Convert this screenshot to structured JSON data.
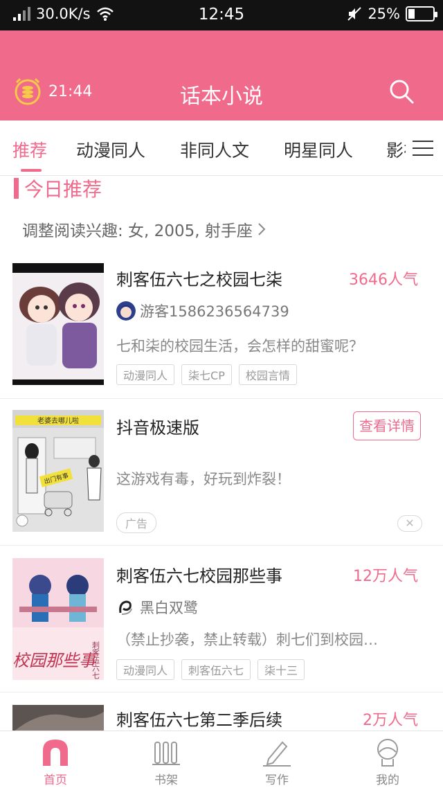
{
  "status_bar": {
    "net_speed": "30.0K/s",
    "time": "12:45",
    "battery": "25%",
    "battery_level": 0.25
  },
  "header": {
    "timer": "21:44",
    "title": "话本小说"
  },
  "tabs": [
    {
      "label": "推荐",
      "active": true
    },
    {
      "label": "动漫同人",
      "active": false
    },
    {
      "label": "非同人文",
      "active": false
    },
    {
      "label": "明星同人",
      "active": false
    },
    {
      "label": "影视",
      "active": false
    }
  ],
  "section": {
    "title": "今日推荐",
    "interest": "调整阅读兴趣: 女, 2005, 射手座"
  },
  "cards": [
    {
      "title": "刺客伍六七之校园七柒",
      "popularity": "3646人气",
      "author": "游客1586236564739",
      "desc": "七和柒的校园生活，会怎样的甜蜜呢？",
      "tags": [
        "动漫同人",
        "柒七CP",
        "校园言情"
      ]
    },
    {
      "title": "抖音极速版",
      "detail_button": "查看详情",
      "desc": "这游戏有毒，好玩到炸裂！",
      "ad_label": "广告",
      "close": "✕",
      "cover_banner": "老婆去哪儿啦",
      "cover_sign": "出门有事"
    },
    {
      "title": "刺客伍六七校园那些事",
      "popularity": "12万人气",
      "author": "黑白双鹭",
      "desc": "（禁止抄袭，禁止转载）刺七们到校园…",
      "tags": [
        "动漫同人",
        "刺客伍六七",
        "柒十三"
      ],
      "cover_text": "校园那些事",
      "cover_small": "刺客伍六七"
    },
    {
      "title": "刺客伍六七第二季后续",
      "popularity": "2万人气"
    }
  ],
  "bottom_nav": [
    {
      "label": "首页",
      "icon": "home-icon",
      "active": true
    },
    {
      "label": "书架",
      "icon": "bookshelf-icon",
      "active": false
    },
    {
      "label": "写作",
      "icon": "pen-icon",
      "active": false
    },
    {
      "label": "我的",
      "icon": "profile-icon",
      "active": false
    }
  ],
  "colors": {
    "accent": "#f06a8c",
    "status_bar": "#121212"
  }
}
